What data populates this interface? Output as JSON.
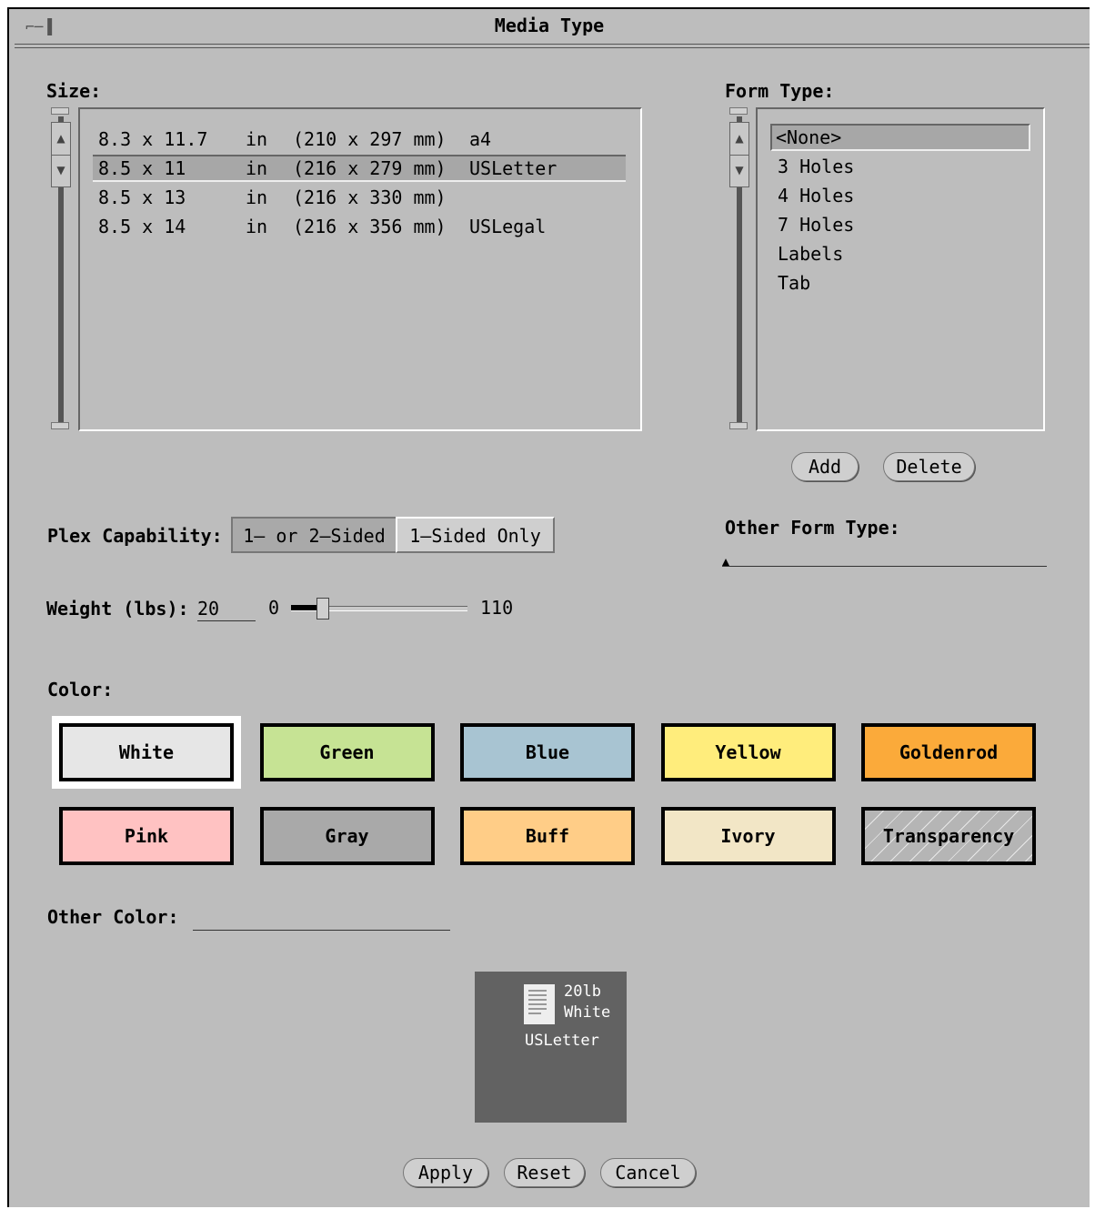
{
  "window": {
    "title": "Media Type"
  },
  "size": {
    "label": "Size:",
    "rows": [
      {
        "dims": "8.3 x 11.7",
        "unit": "in",
        "mm": "(210 x 297 mm)",
        "name": "a4"
      },
      {
        "dims": "8.5 x 11",
        "unit": "in",
        "mm": "(216 x 279 mm)",
        "name": "USLetter",
        "selected": true
      },
      {
        "dims": "8.5 x 13",
        "unit": "in",
        "mm": "(216 x 330 mm)",
        "name": ""
      },
      {
        "dims": "8.5 x 14",
        "unit": "in",
        "mm": "(216 x 356 mm)",
        "name": "USLegal"
      }
    ]
  },
  "form_type": {
    "label": "Form Type:",
    "items": [
      "<None>",
      "3 Holes",
      "4 Holes",
      "7 Holes",
      "Labels",
      "Tab"
    ],
    "selected_index": 0,
    "add_label": "Add",
    "delete_label": "Delete"
  },
  "other_form_type": {
    "label": "Other Form Type:",
    "value": ""
  },
  "plex": {
    "label": "Plex Capability:",
    "options": [
      "1– or 2–Sided",
      "1–Sided Only"
    ],
    "selected_index": 0
  },
  "weight": {
    "label": "Weight (lbs):",
    "value": "20",
    "min": "0",
    "max": "110",
    "level": 20
  },
  "color": {
    "label": "Color:",
    "swatches": [
      {
        "name": "White",
        "hex": "#e6e6e6",
        "selected": true
      },
      {
        "name": "Green",
        "hex": "#c6e394"
      },
      {
        "name": "Blue",
        "hex": "#a8c4d2"
      },
      {
        "name": "Yellow",
        "hex": "#ffed7c"
      },
      {
        "name": "Goldenrod",
        "hex": "#fbaa3a"
      },
      {
        "name": "Pink",
        "hex": "#ffc2c2"
      },
      {
        "name": "Gray",
        "hex": "#a9a9a9"
      },
      {
        "name": "Buff",
        "hex": "#ffcd87"
      },
      {
        "name": "Ivory",
        "hex": "#f2e6c6"
      },
      {
        "name": "Transparency",
        "hex": "#b5b5b5"
      }
    ]
  },
  "other_color": {
    "label": "Other Color:",
    "value": ""
  },
  "preview": {
    "weight": "20lb",
    "color": "White",
    "size": "USLetter"
  },
  "buttons": {
    "apply": "Apply",
    "reset": "Reset",
    "cancel": "Cancel"
  }
}
